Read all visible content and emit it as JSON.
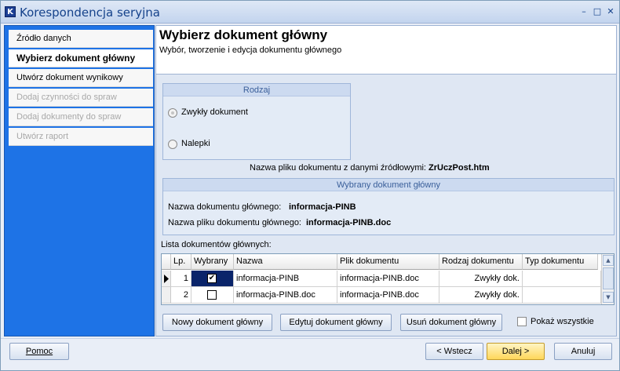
{
  "window": {
    "title": "Korespondencja seryjna",
    "app_icon_glyph": "K",
    "controls": {
      "minimize": "–",
      "maximize": "□",
      "close": "✕"
    }
  },
  "steps": [
    {
      "label": "Źródło danych",
      "state": "normal"
    },
    {
      "label": "Wybierz dokument główny",
      "state": "active"
    },
    {
      "label": "Utwórz dokument wynikowy",
      "state": "normal"
    },
    {
      "label": "Dodaj czynności do spraw",
      "state": "disabled"
    },
    {
      "label": "Dodaj dokumenty do spraw",
      "state": "disabled"
    },
    {
      "label": "Utwórz raport",
      "state": "disabled"
    }
  ],
  "header": {
    "title": "Wybierz dokument główny",
    "subtitle": "Wybór, tworzenie i edycja dokumentu głównego"
  },
  "rodzaj": {
    "title": "Rodzaj",
    "option_zwykly": "Zwykły  dokument",
    "option_nalepki": "Nalepki",
    "selected": "zwykly"
  },
  "source": {
    "label": "Nazwa pliku dokumentu z danymi źródłowymi:",
    "value": "ZrUczPost.htm"
  },
  "selected_doc": {
    "title": "Wybrany dokument główny",
    "name_label": "Nazwa dokumentu głównego:",
    "name_value": "informacja-PINB",
    "file_label": "Nazwa pliku dokumentu głównego:",
    "file_value": "informacja-PINB.doc"
  },
  "list": {
    "label": "Lista dokumentów głównych:",
    "columns": [
      "Lp.",
      "Wybrany",
      "Nazwa",
      "Plik dokumentu",
      "Rodzaj dokumentu",
      "Typ dokumentu"
    ],
    "rows": [
      {
        "lp": "1",
        "checked": true,
        "nazwa": "informacja-PINB",
        "plik": "informacja-PINB.doc",
        "rodzaj": "Zwykły dok.",
        "typ": ""
      },
      {
        "lp": "2",
        "checked": false,
        "nazwa": "informacja-PINB.doc",
        "plik": "informacja-PINB.doc",
        "rodzaj": "Zwykły dok.",
        "typ": ""
      }
    ],
    "check_glyph": "✔"
  },
  "actions": {
    "new": "Nowy dokument główny",
    "edit": "Edytuj dokument główny",
    "delete": "Usuń dokument główny",
    "show_all": "Pokaż wszystkie"
  },
  "footer": {
    "help": "Pomoc",
    "back": "< Wstecz",
    "next": "Dalej >",
    "cancel": "Anuluj"
  },
  "colors": {
    "sidebar": "#1e73e6",
    "title_text": "#15428b",
    "primary_button": "#ffd75a"
  }
}
